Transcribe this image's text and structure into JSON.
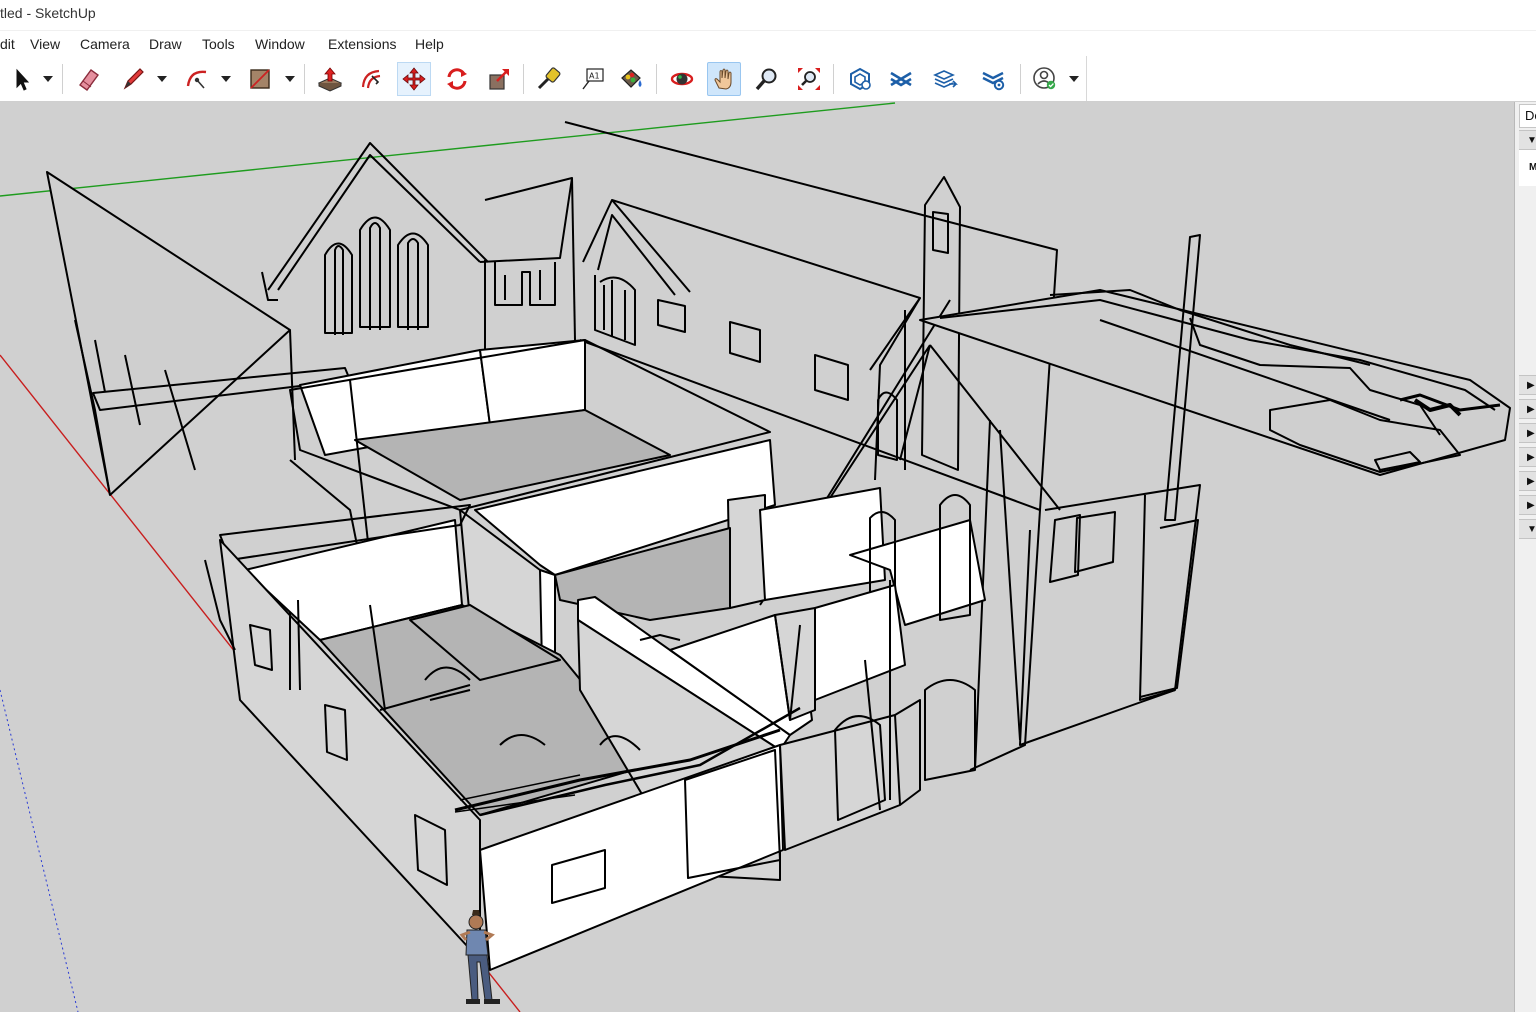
{
  "window": {
    "title": "tled - SketchUp"
  },
  "menu": {
    "items": [
      "dit",
      "View",
      "Camera",
      "Draw",
      "Tools",
      "Window",
      "Extensions",
      "Help"
    ]
  },
  "toolbar": {
    "tools": [
      "select-tool",
      "eraser-tool",
      "line-tool",
      "arc-tool",
      "rectangle-tool",
      "push-pull-tool",
      "offset-tool",
      "move-tool",
      "rotate-tool",
      "scale-tool",
      "tape-measure-tool",
      "text-tool",
      "paint-bucket-tool",
      "orbit-tool",
      "pan-tool",
      "zoom-tool",
      "zoom-extents-tool",
      "layout-send-tool",
      "trimble-connect-tool",
      "3d-warehouse-tool",
      "extension-warehouse-tool",
      "account-tool"
    ],
    "active_tool": "pan-tool"
  },
  "tray": {
    "tab_label": "De",
    "collapsed_label": "M"
  },
  "colors": {
    "viewport_bg": "#d0d0d0",
    "face_front": "#ffffff",
    "face_back": "#b4b4b4",
    "edge": "#000000",
    "axis_red": "#c81e1e",
    "axis_green": "#1e9c1e",
    "axis_blue": "#2a3bd4",
    "active_tool_bg": "#cfe6fb"
  }
}
